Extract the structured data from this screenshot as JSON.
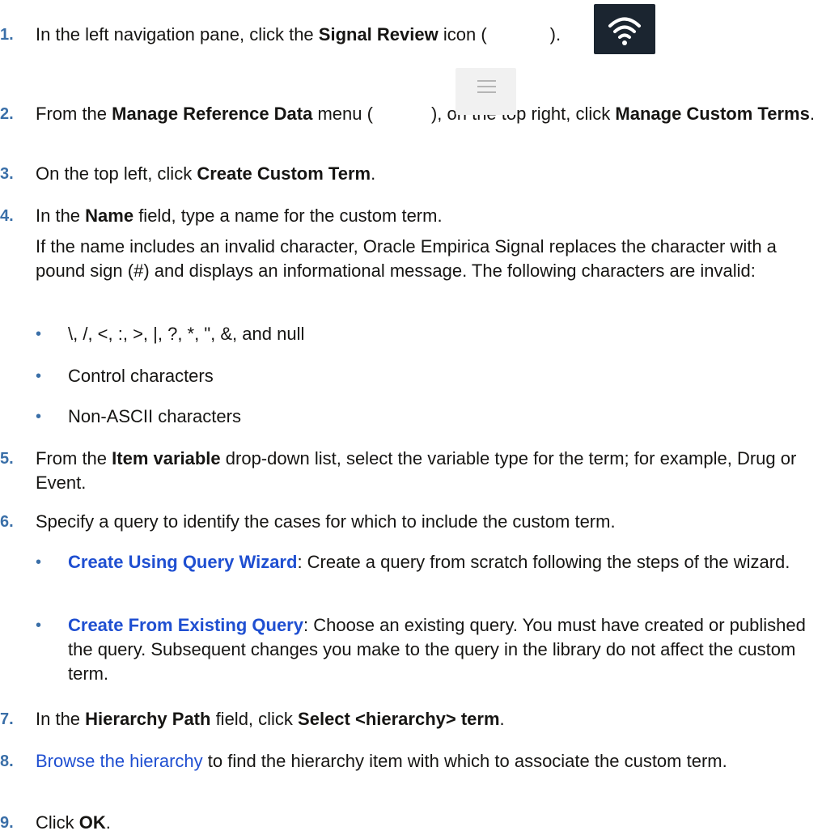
{
  "steps": [
    {
      "number": "1.",
      "parts": [
        "In the left navigation pane, click the ",
        "Signal Review",
        " icon (",
        ")."
      ],
      "icon": "wifi-icon"
    },
    {
      "number": "2.",
      "parts": [
        "From the ",
        "Manage Reference Data",
        " menu (",
        "), on the top right, click ",
        "Manage Custom Terms",
        "."
      ],
      "icon": "hamburger-menu-icon"
    },
    {
      "number": "3.",
      "parts": [
        "On the top left, click ",
        "Create Custom Term",
        "."
      ]
    },
    {
      "number": "4.",
      "parts": [
        "In the ",
        "Name",
        " field, type a name for the custom term."
      ],
      "note": "If the name includes an invalid character, Oracle Empirica Signal replaces the character with a pound sign (#) and displays an informational message. The following characters are invalid:",
      "bullets": [
        "\\, /, <, :, >, |, ?, *, \", &, and null",
        "Control characters",
        "Non-ASCII characters"
      ]
    },
    {
      "number": "5.",
      "parts": [
        "From the ",
        "Item variable",
        " drop-down list, select the variable type for the term; for example, Drug or Event."
      ]
    },
    {
      "number": "6.",
      "parts": [
        "Specify a query to identify the cases for which to include the custom term."
      ],
      "options": [
        {
          "link": "Create Using Query Wizard",
          "text": ": Create a query from scratch following the steps of the wizard."
        },
        {
          "link": "Create From Existing Query",
          "text": ": Choose an existing query. You must have created or published the query. Subsequent changes you make to the query in the library do not affect the custom term."
        }
      ]
    },
    {
      "number": "7.",
      "parts": [
        "In the ",
        "Hierarchy Path",
        " field, click ",
        "Select <hierarchy> term",
        "."
      ]
    },
    {
      "number": "8.",
      "link": "Browse the hierarchy",
      "parts": [
        " to find the hierarchy item with which to associate the custom term."
      ]
    },
    {
      "number": "9.",
      "parts": [
        "Click ",
        "OK",
        "."
      ]
    }
  ],
  "bullet_char": "•",
  "colors": {
    "text": "#161513",
    "number": "#3a6fa8",
    "link": "#1f4fd1",
    "icon_dark": "#1b2530",
    "icon_light": "#f1f1f1"
  }
}
